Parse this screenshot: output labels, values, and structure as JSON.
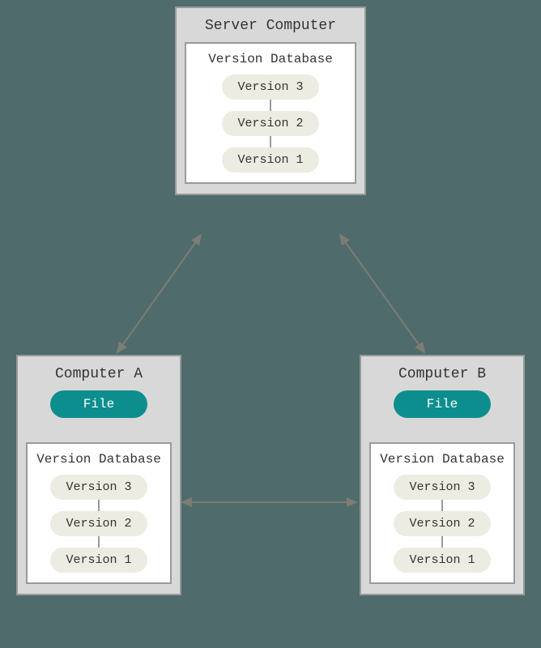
{
  "server": {
    "title": "Server Computer",
    "database": {
      "title": "Version Database",
      "versions": [
        "Version 3",
        "Version 2",
        "Version 1"
      ]
    }
  },
  "clients": [
    {
      "title": "Computer A",
      "file_label": "File",
      "database": {
        "title": "Version Database",
        "versions": [
          "Version 3",
          "Version 2",
          "Version 1"
        ]
      }
    },
    {
      "title": "Computer B",
      "file_label": "File",
      "database": {
        "title": "Version Database",
        "versions": [
          "Version 3",
          "Version 2",
          "Version 1"
        ]
      }
    }
  ],
  "arrows": {
    "color": "#7d7d74"
  }
}
